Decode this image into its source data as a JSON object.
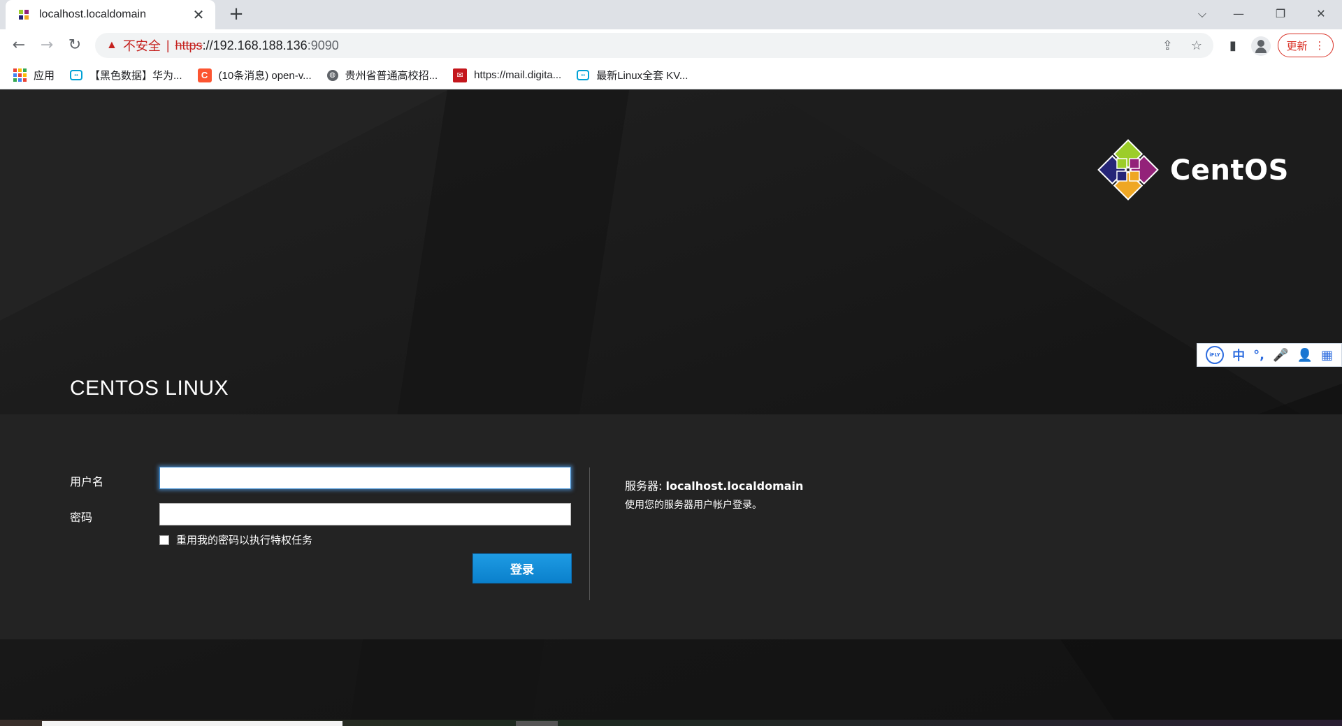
{
  "browser": {
    "tab": {
      "title": "localhost.localdomain",
      "close": "✕"
    },
    "new_tab": "+",
    "window_controls": {
      "dropdown": "⌵",
      "minimize": "—",
      "restore": "❐",
      "close": "✕"
    },
    "nav": {
      "back": "←",
      "forward": "→",
      "reload": "↻"
    },
    "address": {
      "security_label": "不安全",
      "separator": "|",
      "scheme": "https",
      "rest": "://192.168.188.136",
      "port": ":9090"
    },
    "update_label": "更新",
    "update_menu": "⋮",
    "bookmarks": [
      {
        "label": "应用",
        "icon": "apps-grid-icon"
      },
      {
        "label": "【黑色数据】华为...",
        "icon": "bilibili-icon"
      },
      {
        "label": "(10条消息) open-v...",
        "icon": "csdn-icon"
      },
      {
        "label": "贵州省普通高校招...",
        "icon": "globe-icon"
      },
      {
        "label": "https://mail.digita...",
        "icon": "mail-icon"
      },
      {
        "label": "最新Linux全套 KV...",
        "icon": "bilibili-icon"
      }
    ]
  },
  "page": {
    "brand": "CentOS",
    "os_title": "CENTOS LINUX",
    "login": {
      "username_label": "用户名",
      "username_value": "",
      "password_label": "密码",
      "password_value": "",
      "reuse_password_label": "重用我的密码以执行特权任务",
      "reuse_password_checked": false,
      "submit_label": "登录"
    },
    "server": {
      "label": "服务器:",
      "host": "localhost.localdomain",
      "hint": "使用您的服务器用户帐户登录。"
    },
    "ime_toolbar": {
      "logo": "iFLY",
      "items": [
        "中",
        "°,",
        "🎤",
        "👤",
        "▦"
      ]
    }
  },
  "colors": {
    "accent": "#0a80cc",
    "insecure": "#c5221f",
    "panel": "#232323"
  }
}
